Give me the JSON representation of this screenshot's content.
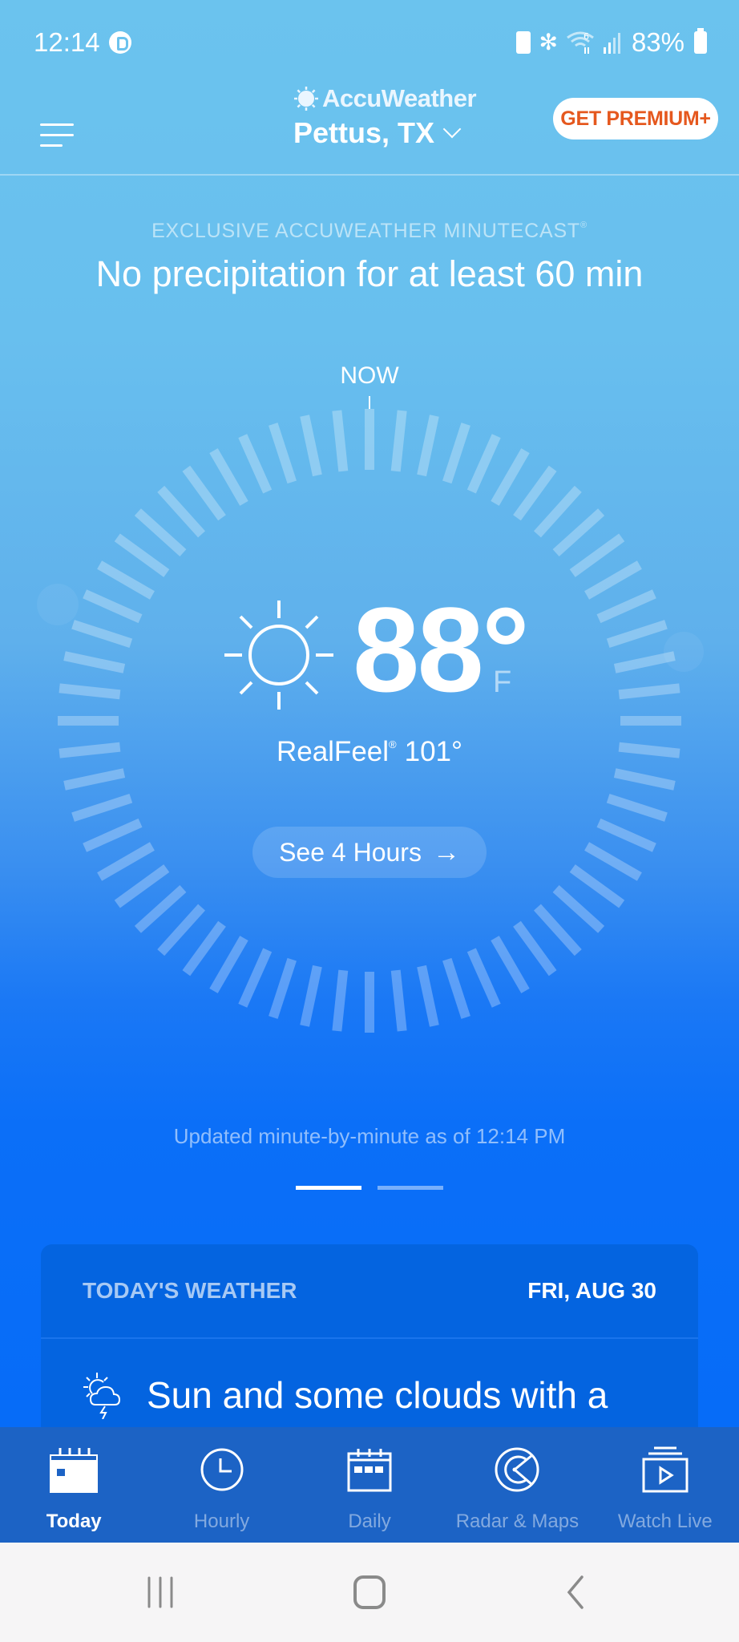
{
  "status_bar": {
    "time": "12:14",
    "battery_percent": "83%",
    "icons": [
      "app-notification-icon",
      "battery-saver-icon",
      "bluetooth-icon",
      "wifi-6-icon",
      "signal-icon",
      "battery-icon"
    ]
  },
  "header": {
    "brand": "AccuWeather",
    "location": "Pettus, TX",
    "premium_label": "GET PREMIUM+",
    "menu_icon": "hamburger-menu-icon"
  },
  "minutecast": {
    "label": "EXCLUSIVE ACCUWEATHER MINUTECAST",
    "label_mark": "®",
    "summary": "No precipitation for at least 60 min",
    "now_label": "NOW",
    "updated_text": "Updated minute-by-minute as of 12:14 PM",
    "page_count": 2,
    "active_page": 0
  },
  "current": {
    "condition_icon": "sun-icon",
    "temperature": "88°",
    "unit": "F",
    "realfeel_label": "RealFeel",
    "realfeel_mark": "®",
    "realfeel_value": "101°",
    "see_hours_label": "See 4 Hours",
    "see_hours_arrow": "→"
  },
  "today_card": {
    "title": "TODAY'S WEATHER",
    "date": "FRI, AUG 30",
    "icon": "partly-sunny-thunderstorm-icon",
    "description": "Sun and some clouds with a"
  },
  "bottom_nav": {
    "items": [
      {
        "label": "Today",
        "icon": "calendar-today-icon",
        "active": true
      },
      {
        "label": "Hourly",
        "icon": "clock-icon",
        "active": false
      },
      {
        "label": "Daily",
        "icon": "calendar-daily-icon",
        "active": false
      },
      {
        "label": "Radar & Maps",
        "icon": "radar-icon",
        "active": false
      },
      {
        "label": "Watch Live",
        "icon": "video-play-icon",
        "active": false
      }
    ]
  },
  "system_nav": {
    "recents": "recents-icon",
    "home": "home-icon",
    "back": "back-icon"
  },
  "colors": {
    "sky_top": "#6bc3ee",
    "sky_bottom": "#066cf8",
    "premium_text": "#e5581e",
    "nav_bar": "#1c63c5",
    "card_bg": "#0464e0"
  }
}
